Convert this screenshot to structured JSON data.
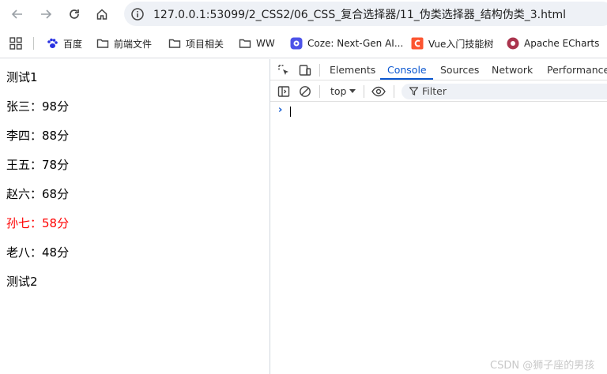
{
  "address_bar": {
    "url": "127.0.0.1:53099/2_CSS2/06_CSS_复合选择器/11_伪类选择器_结构伪类_3.html"
  },
  "bookmarks": [
    {
      "label": "百度",
      "icon": "baidu-paw-icon"
    },
    {
      "label": "前端文件",
      "icon": "folder-icon"
    },
    {
      "label": "项目相关",
      "icon": "folder-icon"
    },
    {
      "label": "WW",
      "icon": "folder-icon"
    },
    {
      "label": "Coze: Next-Gen AI...",
      "icon": "coze-icon"
    },
    {
      "label": "Vue入门技能树",
      "icon": "csdn-c-icon"
    },
    {
      "label": "Apache ECharts",
      "icon": "echarts-icon"
    }
  ],
  "page": {
    "lines": [
      {
        "text": "测试1",
        "highlight": false
      },
      {
        "text": "张三：98分",
        "highlight": false
      },
      {
        "text": "李四：88分",
        "highlight": false
      },
      {
        "text": "王五：78分",
        "highlight": false
      },
      {
        "text": "赵六：68分",
        "highlight": false
      },
      {
        "text": "孙七：58分",
        "highlight": true
      },
      {
        "text": "老八：48分",
        "highlight": false
      },
      {
        "text": "测试2",
        "highlight": false
      }
    ],
    "highlight_color": "#ff0000"
  },
  "devtools": {
    "tabs": [
      "Elements",
      "Console",
      "Sources",
      "Network",
      "Performance"
    ],
    "active_tab": "Console",
    "context": "top",
    "filter_placeholder": "Filter",
    "prompt_symbol": "›",
    "accent_color": "#0b57d0"
  },
  "watermark": "CSDN @狮子座的男孩"
}
